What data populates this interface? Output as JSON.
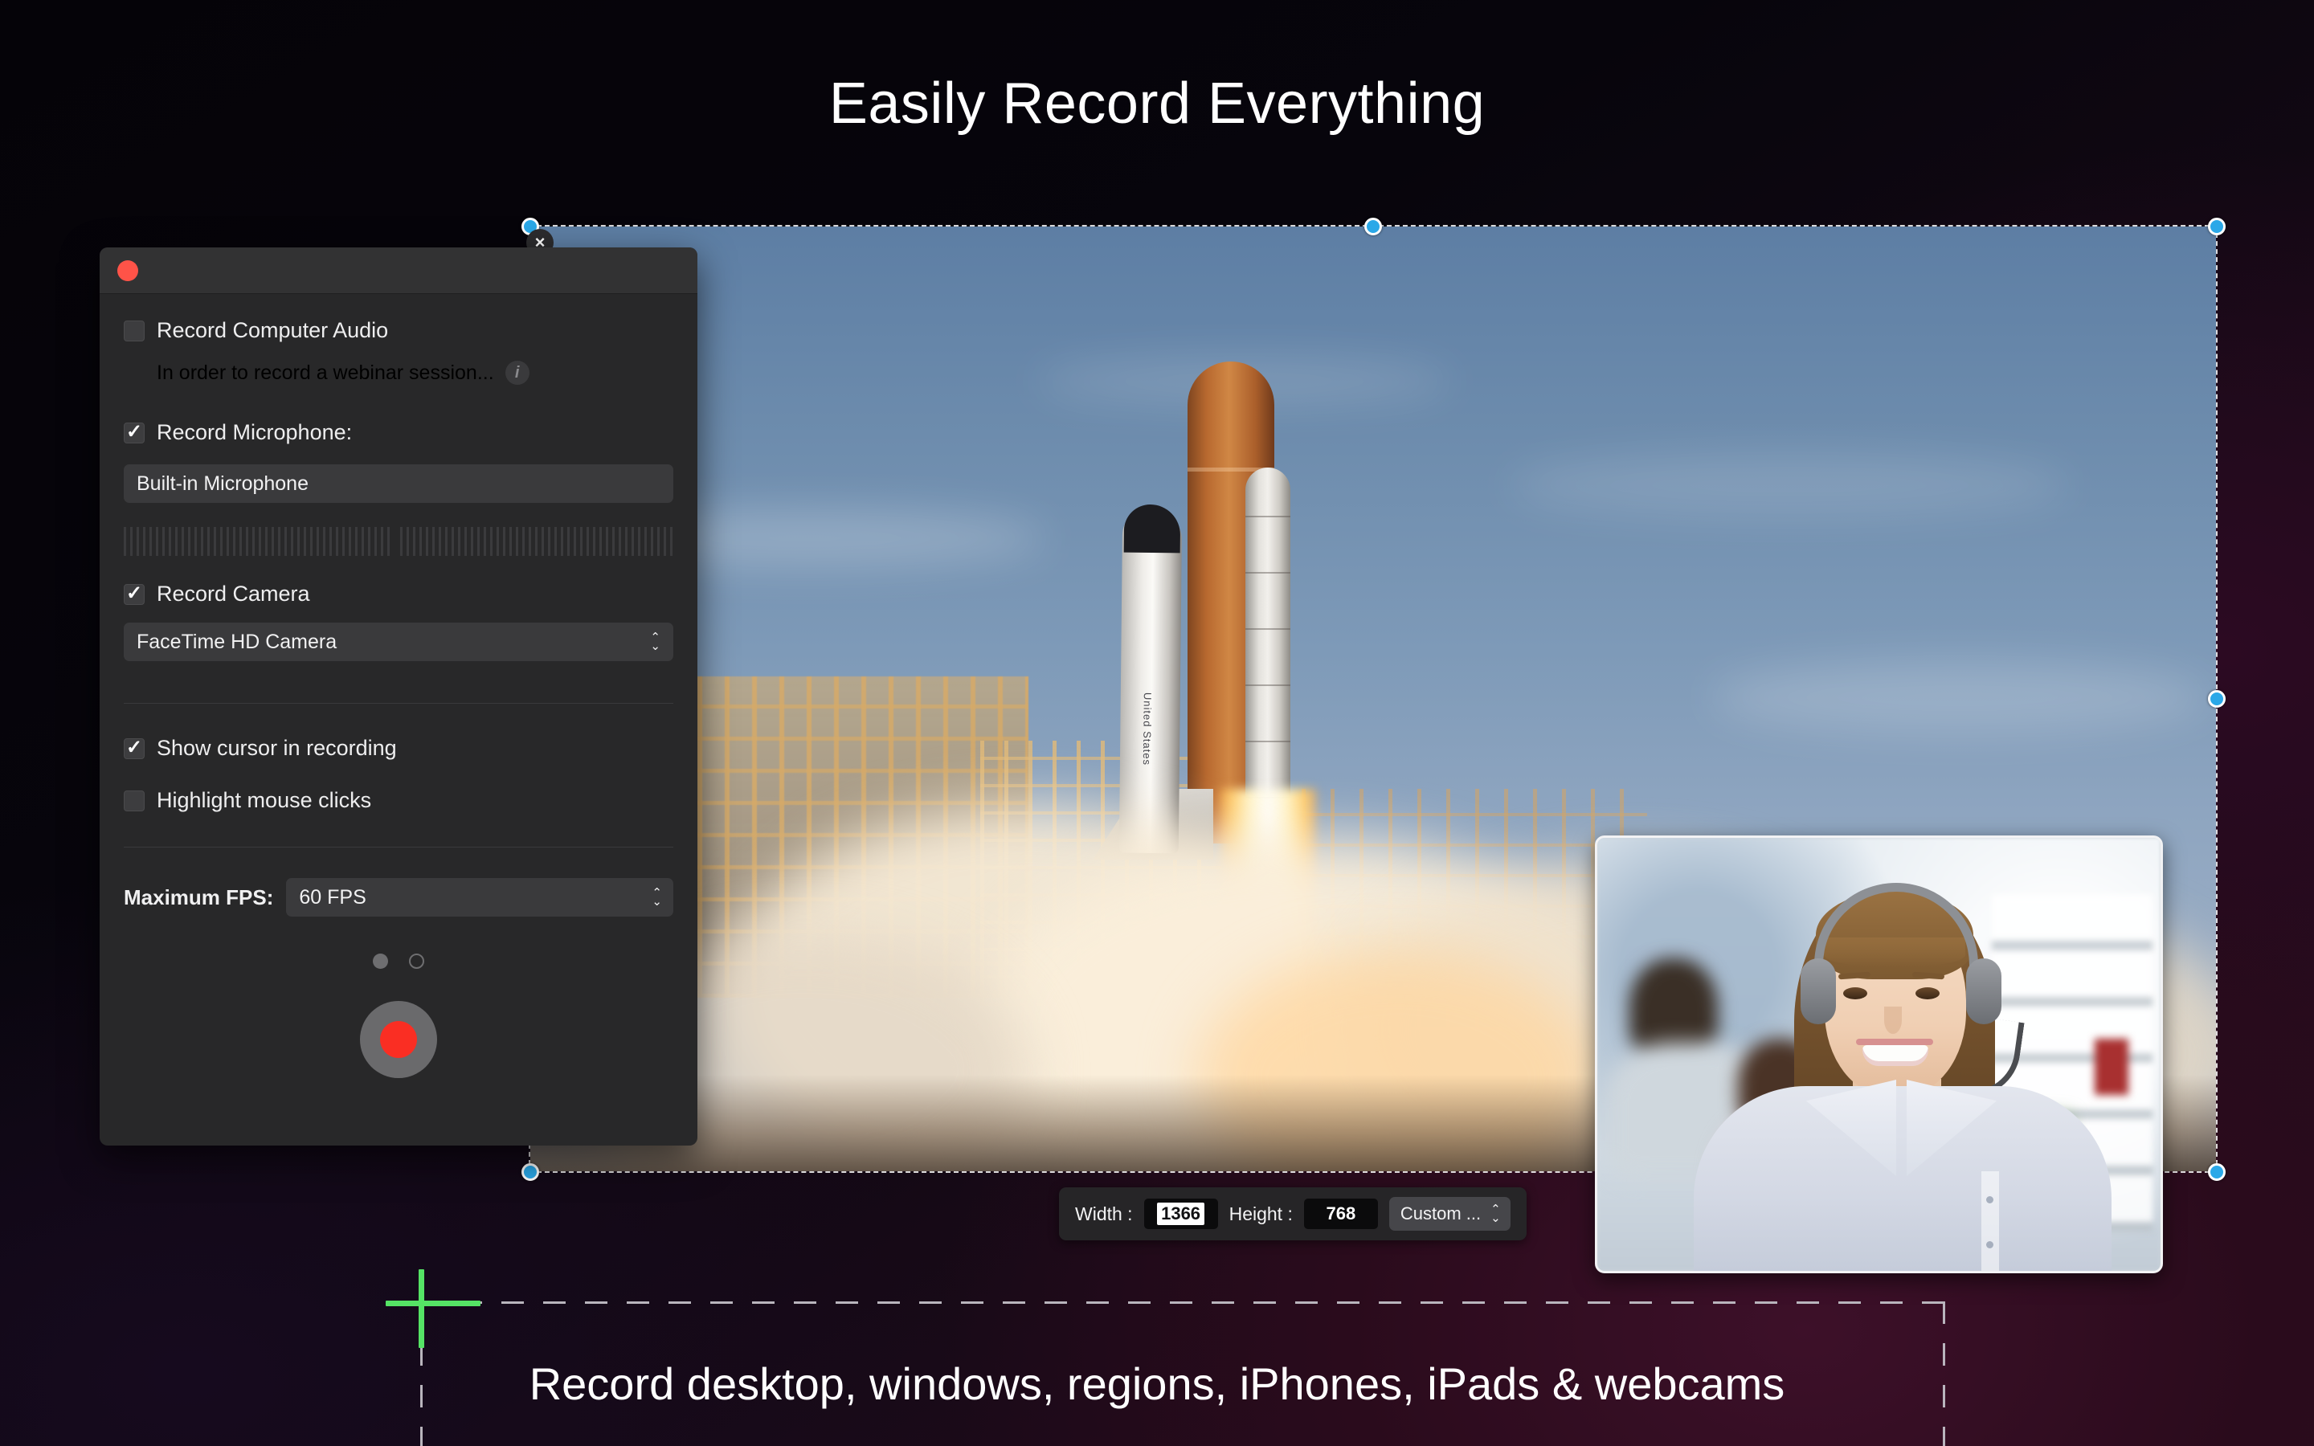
{
  "headline": "Easily Record Everything",
  "caption": "Record desktop, windows, regions, iPhones, iPads & webcams",
  "colors": {
    "accent_red": "#fa2e23",
    "close_red": "#ff5348",
    "handle_blue": "#2aa8e8",
    "crosshair_green": "#55e365",
    "panel_bg": "#282829",
    "titlebar_bg": "#323233"
  },
  "panel": {
    "title": "",
    "close_icon": "close-dot",
    "options": [
      {
        "label": "Record Computer Audio",
        "checked": false
      },
      {
        "label": "Record Microphone:",
        "checked": true
      },
      {
        "label": "Record Camera",
        "checked": true
      },
      {
        "label": "Show cursor in recording",
        "checked": true
      },
      {
        "label": "Highlight mouse clicks",
        "checked": false
      }
    ],
    "audio_hint": "In order to record a webinar session...",
    "info_icon": "i",
    "microphone_value": "Built-in Microphone",
    "camera_value": "FaceTime HD Camera",
    "fps_label": "Maximum FPS:",
    "fps_value": "60 FPS",
    "record_button": "record-button",
    "page_dots": 2,
    "active_dot_index": 0
  },
  "size_toolbar": {
    "width_label": "Width :",
    "width_value": "1366",
    "height_label": "Height :",
    "height_value": "768",
    "preset_value": "Custom ..."
  },
  "capture": {
    "region_close": "×",
    "handles": 8,
    "content_description": "space shuttle launch"
  },
  "webcam": {
    "description": "FaceTime HD Camera preview — support agent with headset"
  }
}
